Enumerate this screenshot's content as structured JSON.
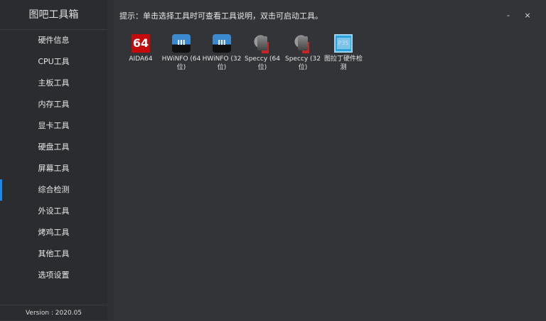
{
  "app": {
    "title": "图吧工具箱",
    "version": "Version : 2020.05"
  },
  "sidebar": {
    "items": [
      {
        "label": "硬件信息"
      },
      {
        "label": "CPU工具"
      },
      {
        "label": "主板工具"
      },
      {
        "label": "内存工具"
      },
      {
        "label": "显卡工具"
      },
      {
        "label": "硬盘工具"
      },
      {
        "label": "屏幕工具"
      },
      {
        "label": "综合检测",
        "active": true
      },
      {
        "label": "外设工具"
      },
      {
        "label": "烤鸡工具"
      },
      {
        "label": "其他工具"
      },
      {
        "label": "选项设置"
      }
    ]
  },
  "header": {
    "hint": "提示：单击选择工具时可查看工具说明，双击可启动工具。",
    "minimize": "-",
    "close": "×"
  },
  "tools": [
    {
      "label": "AIDA64",
      "icon": "aida64-icon",
      "icon_text": "64"
    },
    {
      "label": "HWiNFO (64位)",
      "icon": "hwinfo-icon"
    },
    {
      "label": "HWiNFO (32位)",
      "icon": "hwinfo-icon"
    },
    {
      "label": "Speccy (64位)",
      "icon": "speccy-icon"
    },
    {
      "label": "Speccy (32位)",
      "icon": "speccy-icon"
    },
    {
      "label": "图拉丁硬件检测",
      "icon": "tulading-icon",
      "icon_text": "P3S"
    }
  ],
  "colors": {
    "accent": "#1e88e5",
    "sidebar": "#2b2c2f",
    "main": "#333438"
  }
}
